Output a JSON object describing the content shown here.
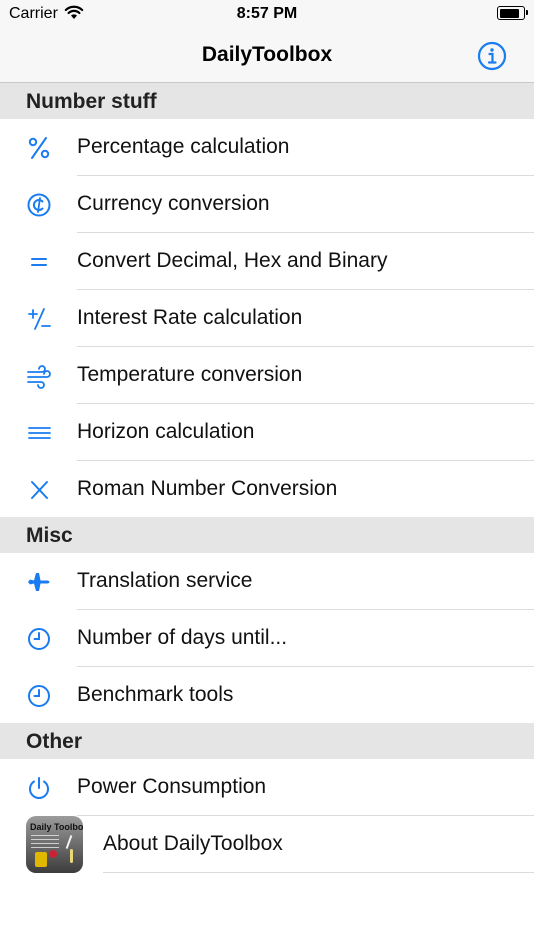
{
  "status": {
    "carrier": "Carrier",
    "time": "8:57 PM",
    "battery_level": 0.95
  },
  "nav": {
    "title": "DailyToolbox",
    "info_icon": "info-circle-icon"
  },
  "colors": {
    "accent": "#1a7cf0",
    "section_bg": "#e5e5e5"
  },
  "sections": [
    {
      "title": "Number stuff",
      "items": [
        {
          "label": "Percentage calculation",
          "icon": "percent-icon"
        },
        {
          "label": "Currency conversion",
          "icon": "cent-circle-icon"
        },
        {
          "label": "Convert Decimal, Hex and Binary",
          "icon": "equals-icon"
        },
        {
          "label": "Interest Rate calculation",
          "icon": "plus-minus-icon"
        },
        {
          "label": "Temperature conversion",
          "icon": "wind-icon"
        },
        {
          "label": "Horizon calculation",
          "icon": "three-lines-icon"
        },
        {
          "label": "Roman Number Conversion",
          "icon": "x-mark-icon"
        }
      ]
    },
    {
      "title": "Misc",
      "items": [
        {
          "label": "Translation service",
          "icon": "airplane-icon"
        },
        {
          "label": "Number of days until...",
          "icon": "clock-icon"
        },
        {
          "label": "Benchmark tools",
          "icon": "clock-icon"
        }
      ]
    },
    {
      "title": "Other",
      "items": [
        {
          "label": "Power Consumption",
          "icon": "power-icon"
        },
        {
          "label": "About DailyToolbox",
          "icon": "app-icon",
          "app_icon_title": "Daily Toolbox"
        }
      ]
    }
  ]
}
